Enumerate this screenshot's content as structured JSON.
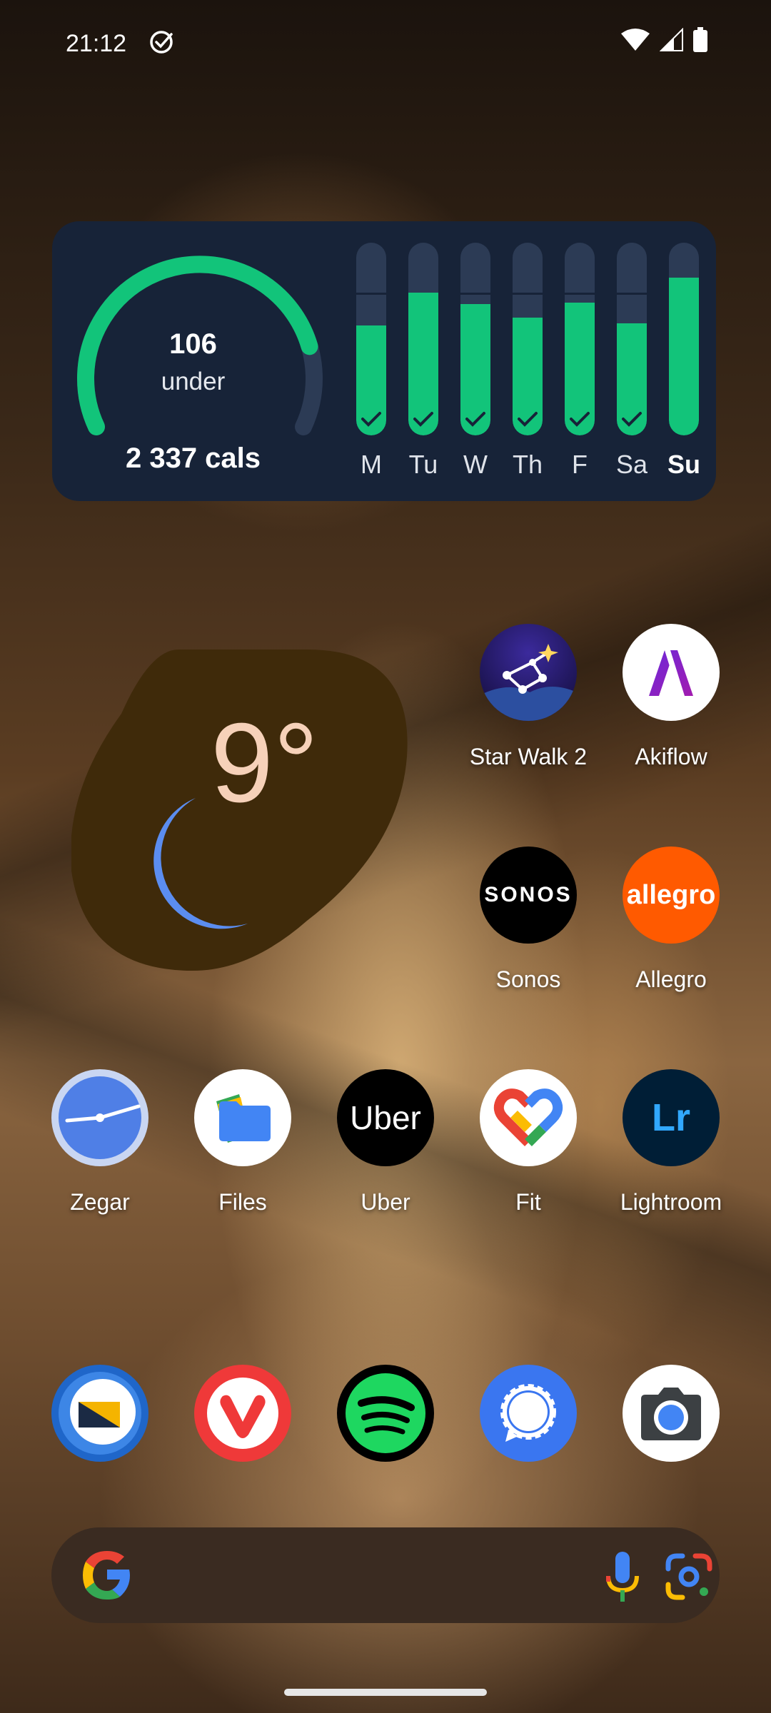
{
  "status_bar": {
    "time": "21:12",
    "icons": [
      "check-circle-icon",
      "wifi-icon",
      "signal-icon",
      "battery-icon"
    ]
  },
  "calorie_widget": {
    "remaining": "106",
    "remaining_label": "under",
    "total": "2 337 cals",
    "gauge_progress": 0.82,
    "days": [
      {
        "label": "M",
        "fill": 0.57,
        "done": true
      },
      {
        "label": "Tu",
        "fill": 0.74,
        "done": true
      },
      {
        "label": "W",
        "fill": 0.68,
        "done": true
      },
      {
        "label": "Th",
        "fill": 0.61,
        "done": true
      },
      {
        "label": "F",
        "fill": 0.69,
        "done": true
      },
      {
        "label": "Sa",
        "fill": 0.58,
        "done": true
      },
      {
        "label": "Su",
        "fill": 0.82,
        "done": false,
        "current": true
      }
    ],
    "colors": {
      "accent": "#12c47a",
      "track": "#2c3b55",
      "background": "#172338"
    }
  },
  "weather_widget": {
    "temperature": "9°",
    "condition_icon": "moon-icon",
    "colors": {
      "background": "#3f2a0a",
      "moon": "#5b8df0",
      "text": "#f6d1b9"
    }
  },
  "apps": {
    "star_walk": "Star Walk 2",
    "akiflow": "Akiflow",
    "sonos": "Sonos",
    "sonos_logo": "SONOS",
    "allegro": "Allegro",
    "allegro_logo": "allegro",
    "zegar": "Zegar",
    "files": "Files",
    "uber": "Uber",
    "uber_logo": "Uber",
    "fit": "Fit",
    "lightroom": "Lightroom",
    "lightroom_logo": "Lr"
  },
  "dock": [
    "mail-icon",
    "vivaldi-icon",
    "spotify-icon",
    "signal-messenger-icon",
    "camera-icon"
  ],
  "search_bar": {
    "icons": [
      "google-g-icon",
      "microphone-icon",
      "google-lens-icon"
    ]
  }
}
